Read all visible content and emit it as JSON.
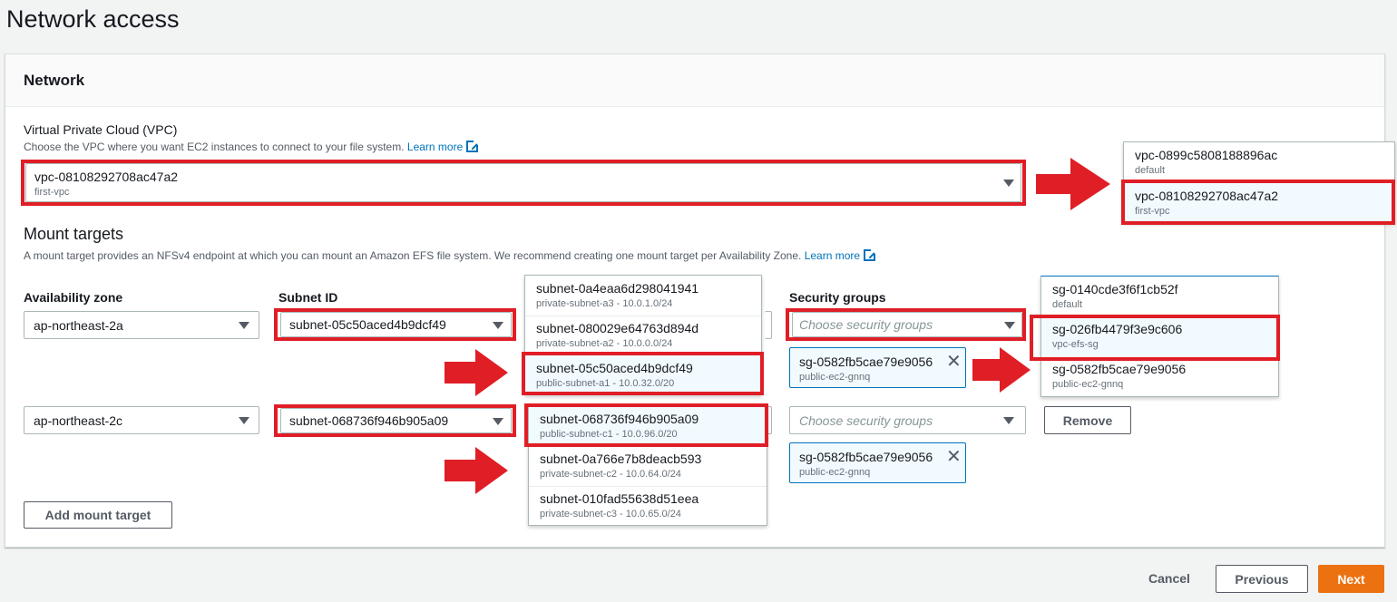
{
  "page_title": "Network access",
  "panel_title": "Network",
  "vpc": {
    "label": "Virtual Private Cloud (VPC)",
    "description": "Choose the VPC where you want EC2 instances to connect to your file system.",
    "learn_more": "Learn more",
    "selected_id": "vpc-08108292708ac47a2",
    "selected_name": "first-vpc",
    "options": [
      {
        "id": "vpc-0899c5808188896ac",
        "name": "default"
      },
      {
        "id": "vpc-08108292708ac47a2",
        "name": "first-vpc"
      }
    ]
  },
  "mount_targets": {
    "title": "Mount targets",
    "description": "A mount target provides an NFSv4 endpoint at which you can mount an Amazon EFS file system. We recommend creating one mount target per Availability Zone.",
    "learn_more": "Learn more",
    "col_az": "Availability zone",
    "col_subnet": "Subnet ID",
    "col_sg": "Security groups",
    "sg_placeholder": "Choose security groups",
    "rows": [
      {
        "az": "ap-northeast-2a",
        "subnet": "subnet-05c50aced4b9dcf49",
        "token_id": "sg-0582fb5cae79e9056",
        "token_name": "public-ec2-gnnq"
      },
      {
        "az": "ap-northeast-2c",
        "subnet": "subnet-068736f946b905a09",
        "token_id": "sg-0582fb5cae79e9056",
        "token_name": "public-ec2-gnnq",
        "remove_label": "Remove"
      }
    ],
    "subnet_dropdown_1": [
      {
        "id": "subnet-0a4eaa6d298041941",
        "detail": "private-subnet-a3 - 10.0.1.0/24"
      },
      {
        "id": "subnet-080029e64763d894d",
        "detail": "private-subnet-a2 - 10.0.0.0/24"
      },
      {
        "id": "subnet-05c50aced4b9dcf49",
        "detail": "public-subnet-a1 - 10.0.32.0/20"
      }
    ],
    "subnet_dropdown_2": [
      {
        "id": "subnet-068736f946b905a09",
        "detail": "public-subnet-c1 - 10.0.96.0/20"
      },
      {
        "id": "subnet-0a766e7b8deacb593",
        "detail": "private-subnet-c2 - 10.0.64.0/24"
      },
      {
        "id": "subnet-010fad55638d51eea",
        "detail": "private-subnet-c3 - 10.0.65.0/24"
      }
    ],
    "sg_dropdown": [
      {
        "id": "sg-0140cde3f6f1cb52f",
        "name": "default"
      },
      {
        "id": "sg-026fb4479f3e9c606",
        "name": "vpc-efs-sg"
      },
      {
        "id": "sg-0582fb5cae79e9056",
        "name": "public-ec2-gnnq"
      }
    ],
    "add_label": "Add mount target"
  },
  "footer": {
    "cancel": "Cancel",
    "previous": "Previous",
    "next": "Next"
  },
  "colors": {
    "annotation_red": "#e01e26",
    "primary_orange": "#ec7211",
    "link_blue": "#0073bb"
  }
}
